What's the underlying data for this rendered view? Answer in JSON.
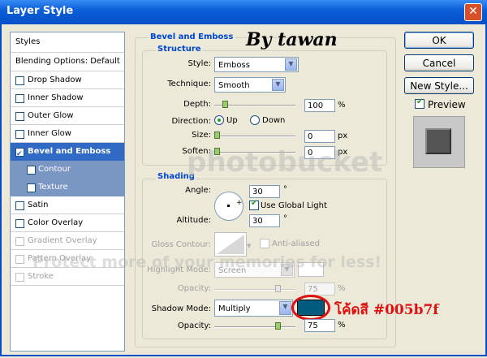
{
  "window": {
    "title": "Layer Style",
    "close_glyph": "✕"
  },
  "styles_list": {
    "header": "Styles",
    "blending": "Blending Options: Default",
    "items": [
      {
        "label": "Drop Shadow",
        "checked": false
      },
      {
        "label": "Inner Shadow",
        "checked": false
      },
      {
        "label": "Outer Glow",
        "checked": false
      },
      {
        "label": "Inner Glow",
        "checked": false
      },
      {
        "label": "Bevel and Emboss",
        "checked": true,
        "selected": true
      },
      {
        "label": "Contour",
        "checked": false,
        "sub": true
      },
      {
        "label": "Texture",
        "checked": false,
        "sub": true
      },
      {
        "label": "Satin",
        "checked": false
      },
      {
        "label": "Color Overlay",
        "checked": false
      },
      {
        "label": "Gradient Overlay",
        "checked": false,
        "disabled": true
      },
      {
        "label": "Pattern Overlay",
        "checked": false,
        "disabled": true
      },
      {
        "label": "Stroke",
        "checked": false,
        "disabled": true
      }
    ]
  },
  "bevel": {
    "group_title": "Bevel and Emboss",
    "structure_title": "Structure",
    "style_label": "Style:",
    "style_value": "Emboss",
    "technique_label": "Technique:",
    "technique_value": "Smooth",
    "depth_label": "Depth:",
    "depth_value": "100",
    "depth_unit": "%",
    "depth_level": 0.1,
    "direction_label": "Direction:",
    "dir_up": "Up",
    "dir_down": "Down",
    "size_label": "Size:",
    "size_value": "0",
    "size_unit": "px",
    "size_level": 0,
    "soften_label": "Soften:",
    "soften_value": "0",
    "soften_unit": "px",
    "soften_level": 0
  },
  "shading": {
    "title": "Shading",
    "angle_label": "Angle:",
    "angle_value": "30",
    "angle_unit": "°",
    "global_light_label": "Use Global Light",
    "altitude_label": "Altitude:",
    "altitude_value": "30",
    "altitude_unit": "°",
    "gloss_label": "Gloss Contour:",
    "anti_aliased": "Anti-aliased",
    "highlight_label": "Highlight Mode:",
    "highlight_value": "Screen",
    "hl_opacity_label": "Opacity:",
    "hl_opacity_value": "75",
    "hl_opacity_unit": "%",
    "shadow_label": "Shadow Mode:",
    "shadow_value": "Multiply",
    "shadow_color": "#005b7f",
    "sh_opacity_label": "Opacity:",
    "sh_opacity_value": "75",
    "sh_opacity_unit": "%"
  },
  "buttons": {
    "ok": "OK",
    "cancel": "Cancel",
    "new_style": "New Style...",
    "preview": "Preview"
  },
  "annotations": {
    "by": "By tawan",
    "color_note": "โค้ดสี #005b7f",
    "watermark": "photobucket",
    "watermark2": "Protect more of your memories for less!"
  }
}
